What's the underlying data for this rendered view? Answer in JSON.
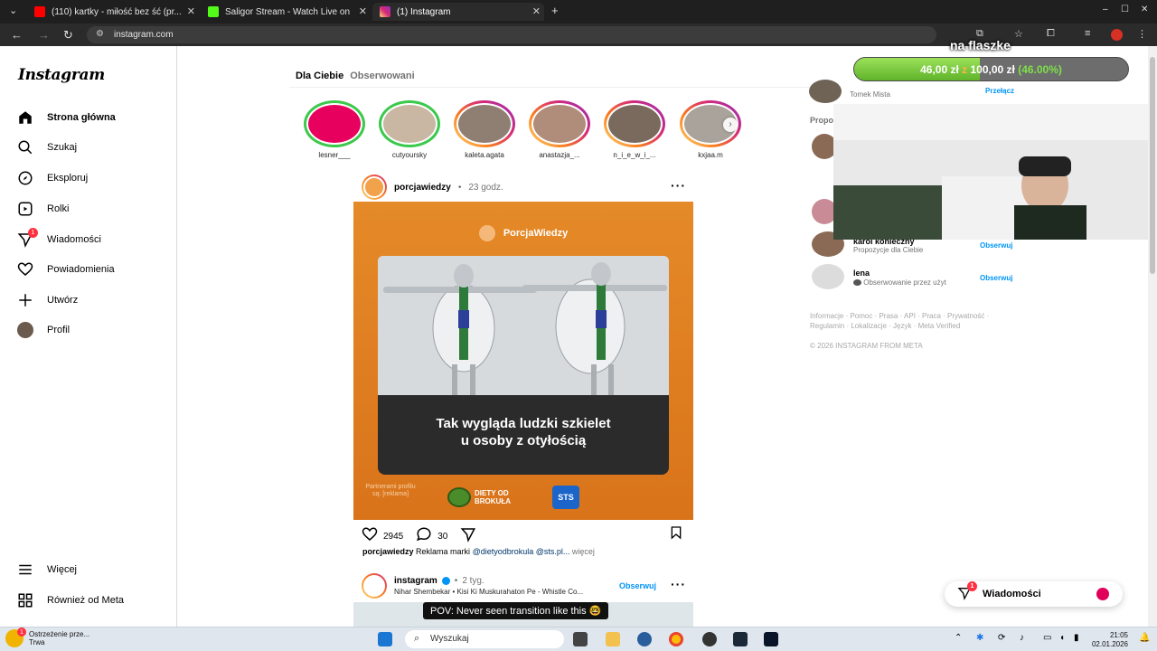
{
  "browser": {
    "tabs": [
      {
        "title": "(110) kartky - miłość bez ść (pr..."
      },
      {
        "title": "Saligor Stream - Watch Live on"
      },
      {
        "title": "(1) Instagram"
      }
    ],
    "url": "instagram.com"
  },
  "sidebar": {
    "logo": "Instagram",
    "items": [
      {
        "label": "Strona główna",
        "icon": "home-icon"
      },
      {
        "label": "Szukaj",
        "icon": "search-icon"
      },
      {
        "label": "Eksploruj",
        "icon": "explore-icon"
      },
      {
        "label": "Rolki",
        "icon": "reels-icon"
      },
      {
        "label": "Wiadomości",
        "icon": "messages-icon",
        "badge": "1"
      },
      {
        "label": "Powiadomienia",
        "icon": "heart-icon"
      },
      {
        "label": "Utwórz",
        "icon": "plus-icon"
      },
      {
        "label": "Profil",
        "icon": "avatar"
      }
    ],
    "bottom": [
      {
        "label": "Więcej",
        "icon": "menu-icon"
      },
      {
        "label": "Również od Meta",
        "icon": "grid-icon"
      }
    ]
  },
  "feed": {
    "tabs": {
      "active": "Dla Ciebie",
      "other": "Obserwowani"
    },
    "stories": [
      "lesner___",
      "cutyoursky",
      "kaleta.agata",
      "anastazja_...",
      "n_i_e_w_i_...",
      "kxjaa.m"
    ],
    "post1": {
      "user": "porcjawiedzy",
      "time": "23 godz.",
      "brand": "PorcjaWiedzy",
      "headline_1": "Tak wygląda ludzki szkielet",
      "headline_2": "u osoby z otyłością",
      "partners": "Partnerami profilu są: [reklama]",
      "diety_1": "DIETY OD",
      "diety_2": "BROKUŁA",
      "sts": "STS",
      "likes": "2945",
      "comments": "30",
      "caption_user": "porcjawiedzy",
      "caption_text": "Reklama marki",
      "caption_mentions": "@dietyodbrokula @sts.pl...",
      "more": "więcej"
    },
    "post2": {
      "user": "instagram",
      "time": "2 tyg.",
      "follow": "Obserwuj",
      "audio": "Nihar Shembekar • Kisi Ki Muskurahaton Pe - Whistle Co...",
      "overlay": "POV: Never seen transition like this 🤓"
    }
  },
  "right": {
    "top_user_sub": "Tomek Mista",
    "switch": "Przełącz",
    "suggest_heading": "Propo",
    "suggestions": [
      {
        "name": "karol konieczny",
        "sub": "Propozycje dla Ciebie",
        "action": "Obserwuj"
      },
      {
        "name": "lena",
        "sub": "Obserwowanie przez użyt",
        "action": "Obserwuj"
      }
    ],
    "footer_1": "Informacje · Pomoc · Prasa · API · Praca · Prywatność ·",
    "footer_2": "Regulamin · Lokalizacje · Język · Meta Verified",
    "copyright": "© 2026 INSTAGRAM FROM META"
  },
  "overlay": {
    "flaszke": "na flaszke",
    "donation_amount": "46,00 zł",
    "donation_sep": "z",
    "donation_goal": "100,00 zł",
    "donation_pct": "(46.00%)",
    "progress": 0.46
  },
  "messages_pill": {
    "label": "Wiadomości",
    "badge": "1"
  },
  "taskbar": {
    "warning_title": "Ostrzeżenie prze...",
    "warning_sub": "Trwa",
    "search": "Wyszukaj",
    "time": "21:05",
    "date": "02.01.2026"
  }
}
